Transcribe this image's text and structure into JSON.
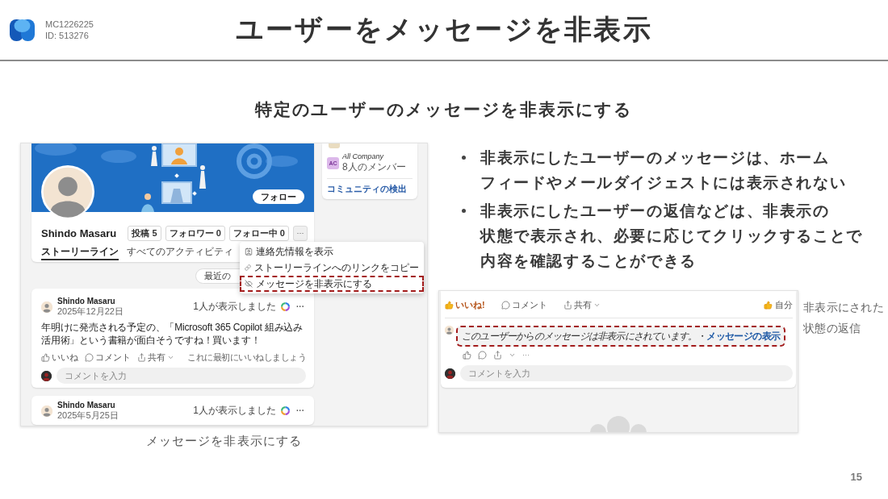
{
  "header": {
    "doc_code": "MC1226225",
    "doc_id": "ID: 513276",
    "title": "ユーザーをメッセージを非表示"
  },
  "subtitle": "特定のユーザーのメッセージを非表示にする",
  "profile_screenshot": {
    "profile": {
      "name": "Shindo Masaru",
      "follow_button": "フォロー",
      "stats": [
        "投稿 5",
        "フォロワー 0",
        "フォロー中 0"
      ],
      "more_button": "···",
      "tabs": [
        {
          "label": "ストーリーライン",
          "selected": true
        },
        {
          "label": "すべてのアクティビティ",
          "selected": false
        }
      ]
    },
    "communities": {
      "items": [
        {
          "badge": "AC",
          "name": "All Company",
          "members": "8人のメンバー"
        }
      ],
      "link": "コミュニティの検出"
    },
    "sort_button": "最近の",
    "menu": [
      {
        "kind": "contact",
        "label": "連絡先情報を表示",
        "highlighted": false
      },
      {
        "kind": "link",
        "label": "ストーリーラインへのリンクをコピー",
        "highlighted": false
      },
      {
        "kind": "hide",
        "label": "メッセージを非表示にする",
        "highlighted": true
      }
    ],
    "posts": [
      {
        "author": "Shindo Masaru",
        "date": "2025年12月22日",
        "views": "1人が表示しました",
        "more": "···",
        "body": "年明けに発売される予定の、「Microsoft 365 Copilot 組み込み活用術」という書籍が面白そうですね！買います！",
        "actions": [
          {
            "kind": "like",
            "label": "いいね",
            "active": false
          },
          {
            "kind": "comment",
            "label": "コメント",
            "active": false
          },
          {
            "kind": "share",
            "label": "共有",
            "active": false
          }
        ],
        "like_prompt": "これに最初にいいねしましょう",
        "comment_placeholder": "コメントを入力"
      },
      {
        "author": "Shindo Masaru",
        "date": "2025年5月25日",
        "views": "1人が表示しました",
        "more": "···"
      }
    ]
  },
  "profile_caption": "メッセージを非表示にする",
  "bullets": [
    {
      "lines": [
        "非表示にしたユーザーのメッセージは、ホーム",
        "フィードやメールダイジェストには表示されない"
      ]
    },
    {
      "lines": [
        "非表示にしたユーザーの返信などは、非表示の",
        "状態で表示され、必要に応じてクリックすることで",
        "内容を確認することができる"
      ]
    }
  ],
  "reply_screenshot": {
    "actions": [
      {
        "kind": "like",
        "label": "いいね!",
        "active": true
      },
      {
        "kind": "comment",
        "label": "コメント",
        "active": false
      },
      {
        "kind": "share",
        "label": "共有",
        "active": false
      }
    ],
    "reaction_summary": "自分",
    "hidden_reply": {
      "message": "このユーザーからのメッセージは非表示にされています。",
      "separator": "・",
      "link": "メッセージの表示",
      "highlighted": true
    },
    "reply_more": "···",
    "comment_placeholder": "コメントを入力"
  },
  "reply_note": {
    "lines": [
      "非表示にされた",
      "状態の返信"
    ]
  },
  "page_number": "15"
}
